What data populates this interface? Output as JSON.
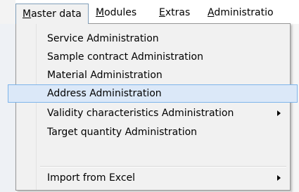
{
  "menubar": {
    "items": [
      {
        "prefix": "",
        "accel": "M",
        "rest": "aster data",
        "active": true
      },
      {
        "prefix": "",
        "accel": "M",
        "rest": "odules",
        "active": false
      },
      {
        "prefix": "",
        "accel": "E",
        "rest": "xtras",
        "active": false
      },
      {
        "prefix": "",
        "accel": "A",
        "rest": "dministratio",
        "active": false
      }
    ]
  },
  "dropdown": {
    "items": [
      {
        "label": "Service Administration"
      },
      {
        "label": "Sample contract Administration"
      },
      {
        "label": "Material Administration"
      },
      {
        "label": "Address Administration",
        "highlighted": true
      },
      {
        "label": "Validity characteristics Administration",
        "submenu": true
      },
      {
        "label": "Target quantity Administration"
      },
      {
        "label": "Import from Excel",
        "submenu": true
      }
    ]
  },
  "colors": {
    "highlight_bg": "#dbe8f8",
    "highlight_border": "#7eb4ea",
    "menu_bg": "#f1f1f1"
  }
}
